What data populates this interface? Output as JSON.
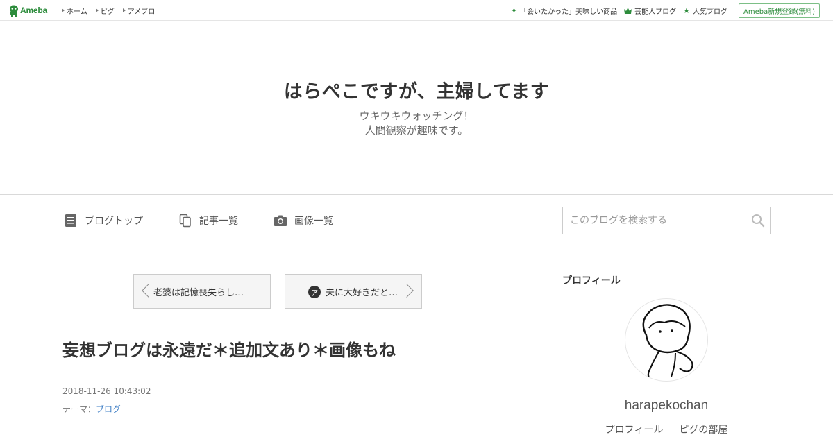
{
  "topbar": {
    "logo_text": "Ameba",
    "nav_left": [
      "ホーム",
      "ピグ",
      "アメブロ"
    ],
    "nav_right": [
      {
        "icon": "sparkle-icon",
        "label": "「会いたかった」美味しい商品"
      },
      {
        "icon": "crown-icon",
        "label": "芸能人ブログ"
      },
      {
        "icon": "star-icon",
        "label": "人気ブログ"
      }
    ],
    "register_label": "Ameba新規登録(無料)"
  },
  "header": {
    "title": "はらぺこですが、主婦してます",
    "description_line1": "ウキウキウォッチング！",
    "description_line2": "人間観察が趣味です。"
  },
  "subnav": {
    "items": [
      {
        "icon": "document-icon",
        "label": "ブログトップ"
      },
      {
        "icon": "copy-icon",
        "label": "記事一覧"
      },
      {
        "icon": "camera-icon",
        "label": "画像一覧"
      }
    ],
    "search_placeholder": "このブログを検索する"
  },
  "entry": {
    "prev_label": "老婆は記憶喪失らし…",
    "next_label": "夫に大好きだと…",
    "next_badge": "ア",
    "title": "妄想ブログは永遠だ＊追加文あり＊画像もね",
    "date": "2018-11-26 10:43:02",
    "theme_prefix": "テーマ：",
    "theme_link": "ブログ"
  },
  "sidebar": {
    "heading": "プロフィール",
    "username": "harapekochan",
    "links": [
      "プロフィール",
      "ピグの部屋"
    ]
  },
  "colors": {
    "brand_green": "#2d8c3c",
    "link_blue": "#3b7cc4"
  }
}
